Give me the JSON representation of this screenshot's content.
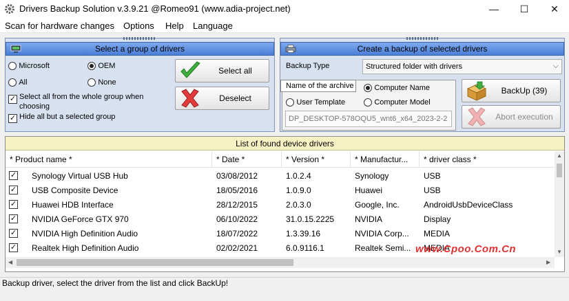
{
  "window": {
    "title": "Drivers Backup Solution v.3.9.21 @Romeo91 (www.adia-project.net)",
    "minimize_glyph": "—",
    "maximize_glyph": "☐",
    "close_glyph": "✕"
  },
  "menu": {
    "items": [
      "Scan for hardware changes",
      "Options",
      "Help",
      "Language"
    ]
  },
  "select_panel": {
    "title": "Select a group of drivers",
    "header_icon": "monitor-icon",
    "radios": [
      {
        "label": "Microsoft",
        "checked": false
      },
      {
        "label": "OEM",
        "checked": true
      },
      {
        "label": "All",
        "checked": false
      },
      {
        "label": "None",
        "checked": false
      }
    ],
    "checkboxes": [
      {
        "label_line1": "Select all from the whole group when",
        "label_line2": "choosing",
        "checked": true
      },
      {
        "label": "Hide all but a selected group",
        "checked": true
      }
    ],
    "select_all_label": "Select all",
    "deselect_label": "Deselect"
  },
  "backup_panel": {
    "title": "Create a backup of selected drivers",
    "header_icon": "printer-icon",
    "backup_type_label": "Backup Type",
    "backup_type_value": "Structured folder with drivers",
    "archive_tab_label": "Name of the archive",
    "archive_options": [
      {
        "label": "Computer Name",
        "checked": true
      },
      {
        "label": "User Template",
        "checked": false
      },
      {
        "label": "Computer Model",
        "checked": false
      }
    ],
    "archive_name": "DP_DESKTOP-578OQU5_wnt6_x64_2023-2-2",
    "backup_button": "BackUp (39)",
    "abort_button": "Abort execution"
  },
  "list": {
    "title": "List of found device drivers",
    "columns": [
      "* Product name *",
      "* Date *",
      "* Version *",
      "* Manufactur...",
      "* driver class *"
    ],
    "rows": [
      {
        "checked": true,
        "product": "Synology Virtual USB Hub",
        "date": "03/08/2012",
        "version": "1.0.2.4",
        "manufacturer": "Synology",
        "class": "USB"
      },
      {
        "checked": true,
        "product": "USB Composite Device",
        "date": "18/05/2016",
        "version": "1.0.9.0",
        "manufacturer": "Huawei",
        "class": "USB"
      },
      {
        "checked": true,
        "product": "Huawei HDB Interface",
        "date": "28/12/2015",
        "version": "2.0.3.0",
        "manufacturer": "Google, Inc.",
        "class": "AndroidUsbDeviceClass"
      },
      {
        "checked": true,
        "product": "NVIDIA GeForce GTX 970",
        "date": "06/10/2022",
        "version": "31.0.15.2225",
        "manufacturer": "NVIDIA",
        "class": "Display"
      },
      {
        "checked": true,
        "product": "NVIDIA High Definition Audio",
        "date": "18/07/2022",
        "version": "1.3.39.16",
        "manufacturer": "NVIDIA Corp...",
        "class": "MEDIA"
      },
      {
        "checked": true,
        "product": "Realtek High Definition Audio",
        "date": "02/02/2021",
        "version": "6.0.9116.1",
        "manufacturer": "Realtek Semi...",
        "class": "MEDIA"
      }
    ]
  },
  "watermark": "www.Cpoo.Com.Cn",
  "status": "Backup driver, select the driver from the list and click BackUp!",
  "colors": {
    "panel_bg": "#d8e1f0",
    "panel_header": "#4a7fd8",
    "list_header": "#f7f2c4",
    "watermark": "#e23131"
  }
}
